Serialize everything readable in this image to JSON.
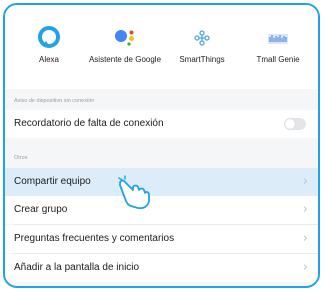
{
  "colors": {
    "accent": "#1fa3e6",
    "highlight": "#dcecf8",
    "alexa": "#1fa3e6",
    "smartthings": "#4aa8d8"
  },
  "services": [
    {
      "name": "Alexa",
      "icon": "alexa-icon"
    },
    {
      "name": "Asistente de Google",
      "icon": "google-assistant-icon"
    },
    {
      "name": "SmartThings",
      "icon": "smartthings-icon"
    },
    {
      "name": "Tmall Genie",
      "icon": "tmall-genie-icon"
    }
  ],
  "offline_section": {
    "label": "Aviso de dispositivo sin conexión",
    "item": {
      "label": "Recordatorio de falta de conexión",
      "enabled": false
    }
  },
  "others_section": {
    "label": "Otros",
    "items": [
      {
        "label": "Compartir equipo",
        "highlighted": true
      },
      {
        "label": "Crear grupo"
      },
      {
        "label": "Preguntas frecuentes y comentarios"
      },
      {
        "label": "Añadir a la pantalla de inicio"
      }
    ]
  }
}
